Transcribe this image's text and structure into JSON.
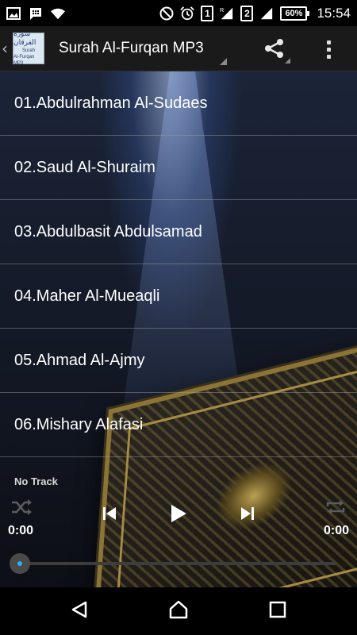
{
  "status_bar": {
    "time": "15:54",
    "battery": "60%",
    "sim1": "1",
    "sim1_sup": "R",
    "sim2": "2",
    "icons": [
      "gallery-icon",
      "messenger-icon",
      "wifi-icon",
      "do-not-disturb-icon",
      "alarm-icon",
      "signal-icon",
      "battery-icon"
    ]
  },
  "action_bar": {
    "logo_arabic": "سورة الفرقان",
    "logo_line1": "Surah",
    "logo_line2": "Al-Furqan MP3",
    "title": "Surah Al-Furqan MP3",
    "share_icon": "share-icon",
    "overflow_icon": "overflow-menu-icon"
  },
  "reciters": [
    {
      "label": "01.Abdulrahman Al-Sudaes"
    },
    {
      "label": "02.Saud Al-Shuraim"
    },
    {
      "label": "03.Abdulbasit Abdulsamad"
    },
    {
      "label": "04.Maher Al-Mueaqli"
    },
    {
      "label": "05.Ahmad Al-Ajmy"
    },
    {
      "label": "06.Mishary Alafasi"
    }
  ],
  "player": {
    "track": "No Track",
    "elapsed": "0:00",
    "duration": "0:00",
    "progress": 0,
    "accent": "#33aaff"
  },
  "nav_bar": {
    "icons": [
      "back-triangle-icon",
      "home-circle-icon",
      "recents-square-icon"
    ]
  }
}
